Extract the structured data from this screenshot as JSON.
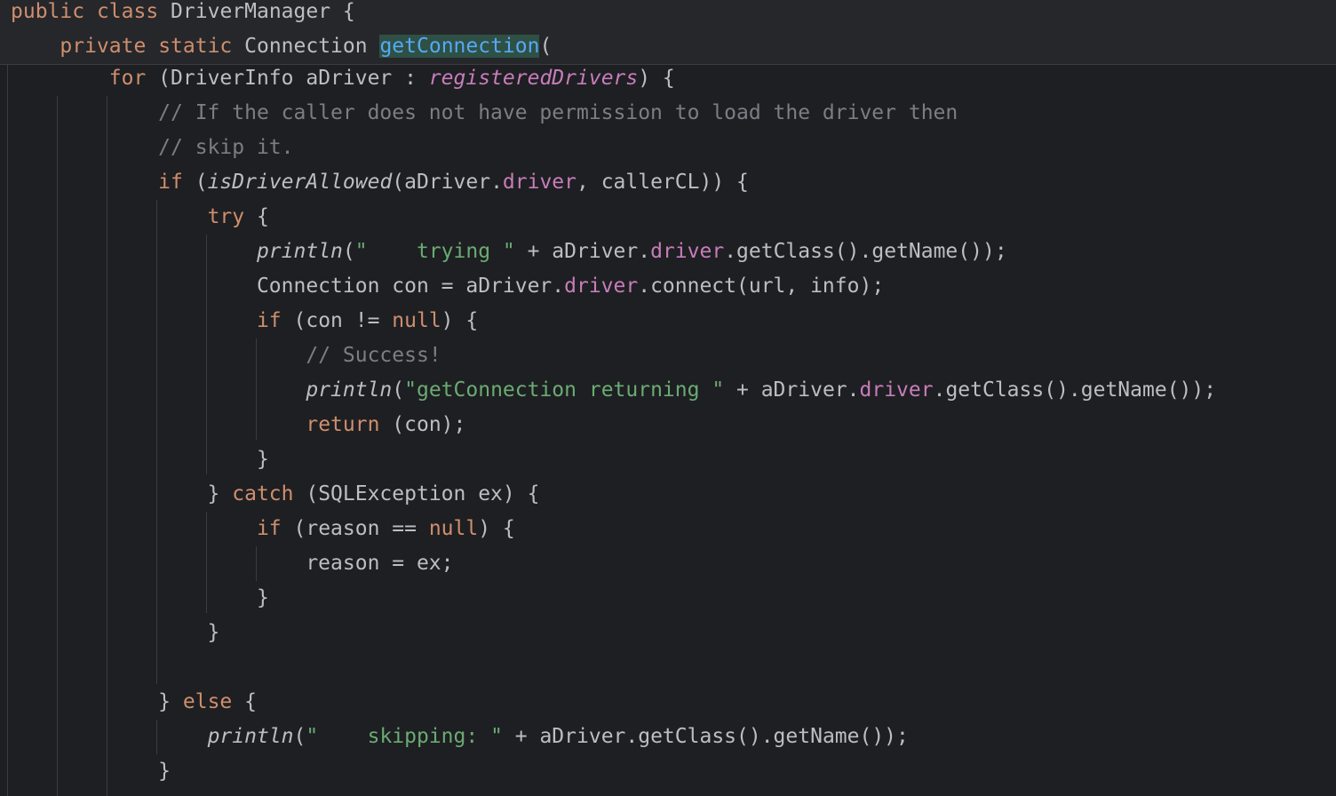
{
  "editor": {
    "language": "Java",
    "colors": {
      "background": "#1e1f22",
      "keyword": "#cf8e6d",
      "string": "#6aab73",
      "comment": "#7a7e85",
      "field": "#c77dbb",
      "method_declaration": "#56a8f5",
      "identifier": "#bcbec4"
    },
    "lines": [
      "public class DriverManager {",
      "    private static Connection getConnection(",
      "        for (DriverInfo aDriver : registeredDrivers) {",
      "            // If the caller does not have permission to load the driver then",
      "            // skip it.",
      "            if (isDriverAllowed(aDriver.driver, callerCL)) {",
      "                try {",
      "                    println(\"    trying \" + aDriver.driver.getClass().getName());",
      "                    Connection con = aDriver.driver.connect(url, info);",
      "                    if (con != null) {",
      "                        // Success!",
      "                        println(\"getConnection returning \" + aDriver.driver.getClass().getName());",
      "                        return (con);",
      "                    }",
      "                } catch (SQLException ex) {",
      "                    if (reason == null) {",
      "                        reason = ex;",
      "                    }",
      "                }",
      "",
      "            } else {",
      "                println(\"    skipping: \" + aDriver.getClass().getName());",
      "            }"
    ]
  }
}
